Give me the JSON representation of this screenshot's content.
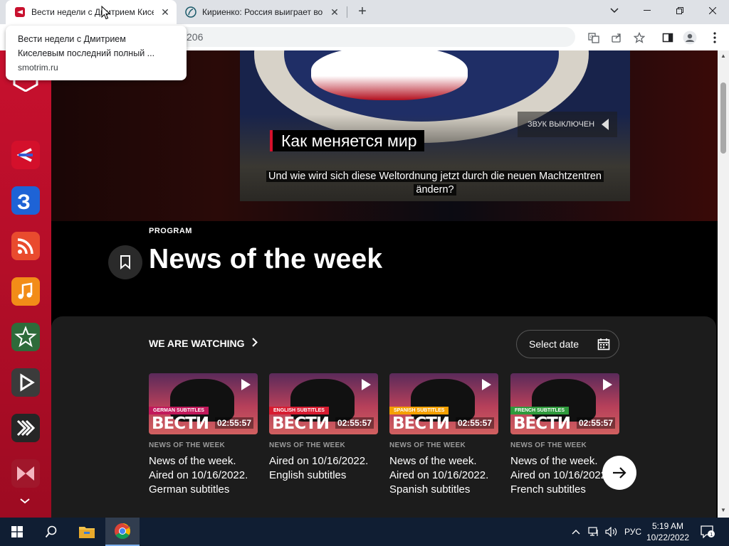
{
  "browser": {
    "tabs": [
      {
        "title": "Вести недели с Дмитрием Киселевым последний полный выпуск",
        "active": true,
        "favicon": "smotrim-icon"
      },
      {
        "title": "Кириенко: Россия выиграет вой",
        "active": false,
        "favicon": "globe-icon"
      }
    ],
    "new_tab": "+",
    "address_fragment": "206",
    "tooltip": {
      "title": "Вести недели с Дмитрием Киселевым последний полный ...",
      "url": "smotrim.ru"
    }
  },
  "page": {
    "video": {
      "banner": "Как меняется мир",
      "sound_label": "ЗВУК ВЫКЛЮЧЕН",
      "subtitle_line1": "Und wie wird sich diese Weltordnung jetzt durch die neuen Machtzentren",
      "subtitle_line2": "ändern?"
    },
    "program_label": "PROGRAM",
    "title": "News of the week",
    "watching_label": "WE ARE WATCHING",
    "select_date_label": "Select date",
    "cards": [
      {
        "tag": "GERMAN SUBTITLES",
        "tag_color": "#c2185b",
        "logo": "ВЕСТИ",
        "duration": "02:55:57",
        "kicker": "NEWS OF THE WEEK",
        "line1": "News of the week.",
        "line2": "Aired on 10/16/2022.",
        "line3": "German subtitles"
      },
      {
        "tag": "ENGLISH SUBTITLES",
        "tag_color": "#d81b30",
        "logo": "ВЕСТИ",
        "duration": "02:55:57",
        "kicker": "NEWS OF THE WEEK",
        "line1": "Aired on 10/16/2022.",
        "line2": "English subtitles",
        "line3": ""
      },
      {
        "tag": "SPANISH SUBTITLES",
        "tag_color": "#f5a000",
        "logo": "ВЕСТИ",
        "duration": "02:55:57",
        "kicker": "NEWS OF THE WEEK",
        "line1": "News of the week.",
        "line2": "Aired on 10/16/2022.",
        "line3": "Spanish subtitles"
      },
      {
        "tag": "FRENCH SUBTITLES",
        "tag_color": "#2e9a3c",
        "logo": "ВЕСТИ",
        "duration": "02:55:57",
        "kicker": "NEWS OF THE WEEK",
        "line1": "News of the week.",
        "line2": "Aired on 10/16/2022.",
        "line3": "French subtitles"
      }
    ]
  },
  "rail": [
    {
      "name": "russia1-icon",
      "color": "#d4102b"
    },
    {
      "name": "kultura-icon",
      "color": "#1e63d6"
    },
    {
      "name": "podcast-icon",
      "color": "#e94b2e"
    },
    {
      "name": "music-icon",
      "color": "#f28c18"
    },
    {
      "name": "zvezda-icon",
      "color": "#2e6b3a"
    },
    {
      "name": "play-icon",
      "color": "#444"
    },
    {
      "name": "stripes-icon",
      "color": "#2a2a2a"
    },
    {
      "name": "bowtie-icon",
      "color": "#a0172b"
    }
  ],
  "taskbar": {
    "lang": "РУС",
    "time": "5:19 AM",
    "date": "10/22/2022",
    "notifications": "1"
  }
}
